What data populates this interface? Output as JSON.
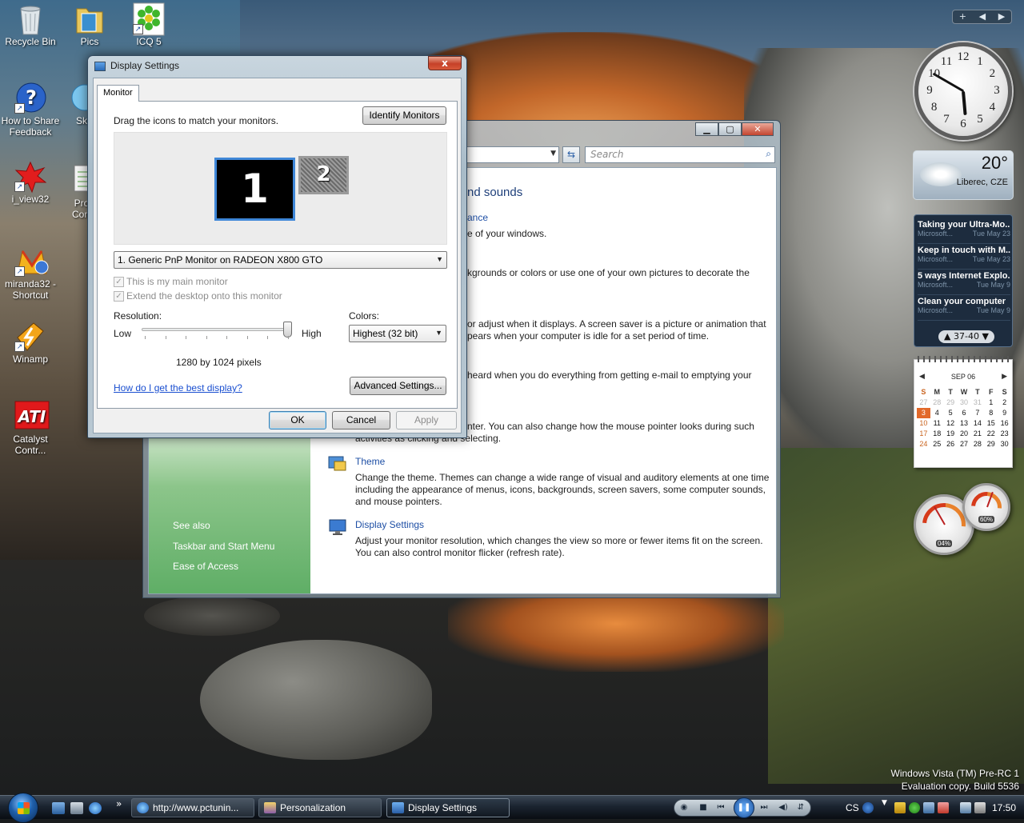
{
  "desktop": {
    "icons": [
      {
        "label": "Recycle Bin"
      },
      {
        "label": "Pics"
      },
      {
        "label": "ICQ 5"
      },
      {
        "label": "How to Share Feedback"
      },
      {
        "label": "Sk"
      },
      {
        "label": "i_view32"
      },
      {
        "label": "Pro Comp"
      },
      {
        "label": "miranda32 - Shortcut"
      },
      {
        "label": "Winamp"
      },
      {
        "label": "Catalyst Contr..."
      }
    ],
    "watermark": {
      "line1": "Windows Vista (TM) Pre-RC 1",
      "line2": "Evaluation copy. Build 5536"
    }
  },
  "background_window": {
    "title": "Personalization",
    "search_placeholder": "Search",
    "heading_fragment": "nd sounds",
    "items": [
      {
        "title": "ance",
        "desc": "e of your windows."
      },
      {
        "title": "",
        "desc": "kgrounds or colors or use one of your own pictures to decorate the"
      },
      {
        "title": "",
        "desc": "or adjust when it displays. A screen saver is a picture or animation that",
        "desc2": "pears when your computer is idle for a set period of time."
      },
      {
        "title": "",
        "desc": "heard when you do everything from getting e-mail to emptying your"
      },
      {
        "title": "",
        "desc": "nter. You can also change how the mouse pointer looks during such",
        "desc2": "activities as clicking and selecting."
      },
      {
        "title": "Theme",
        "desc": "Change the theme. Themes can change a wide range of visual and auditory elements at one time",
        "desc2": "including the appearance of menus, icons, backgrounds, screen savers, some computer sounds,",
        "desc3": "and mouse pointers."
      },
      {
        "title": "Display Settings",
        "desc": "Adjust your monitor resolution, which changes the view so more or fewer items fit on the screen.",
        "desc2": "You can also control monitor flicker (refresh rate)."
      }
    ],
    "see_also": {
      "heading": "See also",
      "links": [
        "Taskbar and Start Menu",
        "Ease of Access"
      ]
    }
  },
  "dialog": {
    "title": "Display Settings",
    "close_label": "x",
    "tab_label": "Monitor",
    "instructions": "Drag the icons to match your monitors.",
    "identify_button": "Identify Monitors",
    "monitor1_label": "1",
    "monitor2_label": "2",
    "monitor_select_value": "1. Generic PnP Monitor on RADEON X800 GTO",
    "main_monitor_label": "This is my main monitor",
    "main_monitor_checked": true,
    "extend_label": "Extend the desktop onto this monitor",
    "extend_checked": true,
    "resolution_label": "Resolution:",
    "low_label": "Low",
    "high_label": "High",
    "resolution_value_fraction": 1.0,
    "resolution_text": "1280 by 1024 pixels",
    "colors_label": "Colors:",
    "colors_value": "Highest (32 bit)",
    "help_link": "How do I get the best display?",
    "advanced_button": "Advanced Settings...",
    "ok_button": "OK",
    "cancel_button": "Cancel",
    "apply_button": "Apply"
  },
  "gadgets": {
    "toolbar": {
      "add": "+",
      "prev": "◀",
      "next": "▶"
    },
    "clock": {
      "hour": 5,
      "minute": 50,
      "numbers": [
        "12",
        "1",
        "2",
        "3",
        "4",
        "5",
        "6",
        "7",
        "8",
        "9",
        "10",
        "11"
      ]
    },
    "weather": {
      "temp": "20°",
      "city": "Liberec, CZE"
    },
    "feeds": [
      {
        "title": "Taking your Ultra-Mo...",
        "source": "Microsoft...",
        "date": "Tue May 23"
      },
      {
        "title": "Keep in touch with M...",
        "source": "Microsoft...",
        "date": "Tue May 23"
      },
      {
        "title": "5 ways Internet Explo...",
        "source": "Microsoft...",
        "date": "Tue May 9"
      },
      {
        "title": "Clean your computer",
        "source": "Microsoft...",
        "date": "Tue May 9"
      }
    ],
    "feed_nav": "37-40",
    "calendar": {
      "month": "SEP 06",
      "days_of_week": [
        "S",
        "M",
        "T",
        "W",
        "T",
        "F",
        "S"
      ],
      "weeks": [
        [
          "27",
          "28",
          "29",
          "30",
          "31",
          "1",
          "2"
        ],
        [
          "3",
          "4",
          "5",
          "6",
          "7",
          "8",
          "9"
        ],
        [
          "10",
          "11",
          "12",
          "13",
          "14",
          "15",
          "16"
        ],
        [
          "17",
          "18",
          "19",
          "20",
          "21",
          "22",
          "23"
        ],
        [
          "24",
          "25",
          "26",
          "27",
          "28",
          "29",
          "30"
        ]
      ],
      "today": "3"
    },
    "cpu_meter": {
      "value": "04%"
    },
    "mem_meter": {
      "value": "60%"
    }
  },
  "taskbar": {
    "buttons": [
      {
        "label": "http://www.pctunin..."
      },
      {
        "label": "Personalization"
      },
      {
        "label": "Display Settings"
      }
    ],
    "quicklaunch_more": "»",
    "language": "CS",
    "time": "17:50"
  }
}
